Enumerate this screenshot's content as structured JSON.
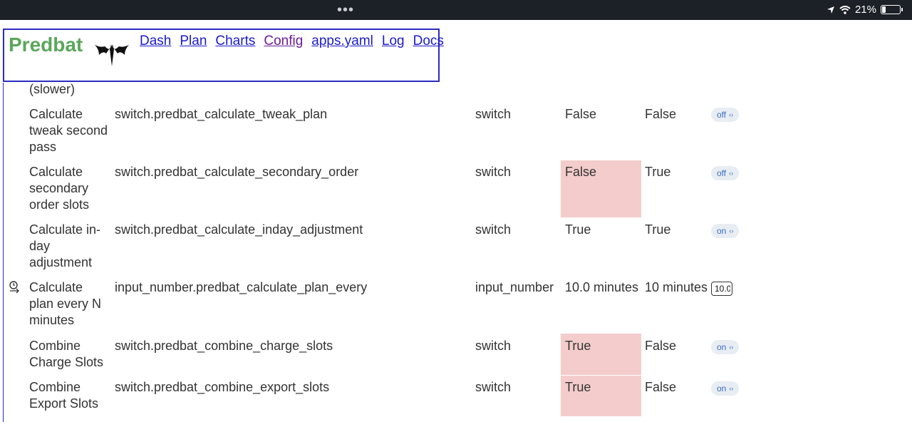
{
  "status_bar": {
    "dots": "•••",
    "battery": "21%"
  },
  "header": {
    "brand": "Predbat",
    "nav": [
      "Dash",
      "Plan",
      "Charts",
      "Config",
      "apps.yaml",
      "Log",
      "Docs"
    ]
  },
  "partial_row_text": "(slower)",
  "rows": [
    {
      "name": "Calculate tweak second pass",
      "entity": "switch.predbat_calculate_tweak_plan",
      "type": "switch",
      "value": "False",
      "default": "False",
      "control": "off",
      "changed": false
    },
    {
      "name": "Calculate secondary order slots",
      "entity": "switch.predbat_calculate_secondary_order",
      "type": "switch",
      "value": "False",
      "default": "True",
      "control": "off",
      "changed": true
    },
    {
      "name": "Calculate in-day adjustment",
      "entity": "switch.predbat_calculate_inday_adjustment",
      "type": "switch",
      "value": "True",
      "default": "True",
      "control": "on",
      "changed": false
    },
    {
      "name": "Calculate plan every N minutes",
      "entity": "input_number.predbat_calculate_plan_every",
      "type": "input_number",
      "value": "10.0 minutes",
      "default": "10 minutes",
      "control": "10.0",
      "changed": false
    },
    {
      "name": "Combine Charge Slots",
      "entity": "switch.predbat_combine_charge_slots",
      "type": "switch",
      "value": "True",
      "default": "False",
      "control": "on",
      "changed": true
    },
    {
      "name": "Combine Export Slots",
      "entity": "switch.predbat_combine_export_slots",
      "type": "switch",
      "value": "True",
      "default": "False",
      "control": "on",
      "changed": true
    }
  ],
  "colors": {
    "brand": "#5aa75a",
    "link": "#1a1acc",
    "visited_link": "#6a1b9a",
    "changed_highlight": "#f4cccc",
    "border": "#2b2bc0"
  }
}
